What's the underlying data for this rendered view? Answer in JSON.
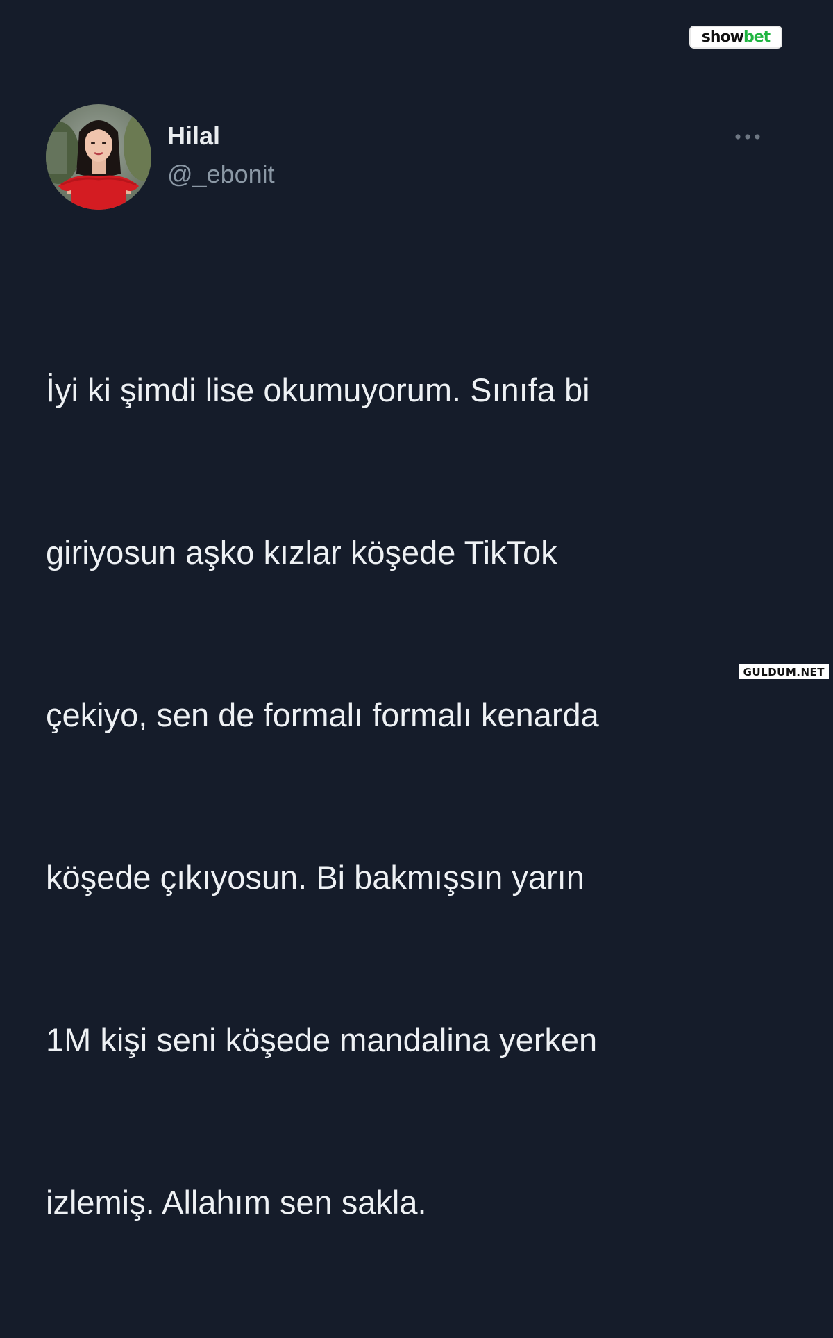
{
  "logo": {
    "part1": "show",
    "part2": "bet",
    "accent_color": "#1fb541"
  },
  "tweet": {
    "author_name": "Hilal",
    "author_handle": "@_ebonit",
    "more_icon": "more-horizontal-icon",
    "text_lines": [
      "İyi ki şimdi lise okumuyorum. Sınıfa bi",
      "giriyosun aşko kızlar köşede TikTok",
      "çekiyo, sen de formalı formalı kenarda",
      "köşede çıkıyosun. Bi bakmışsın yarın",
      "1M kişi seni köşede mandalina yerken",
      "izlemiş. Allahım sen sakla."
    ]
  },
  "watermark": "GULDUM.NET",
  "colors": {
    "background": "#151c2a",
    "text": "#eef1f4",
    "secondary_text": "#8b98a5"
  }
}
